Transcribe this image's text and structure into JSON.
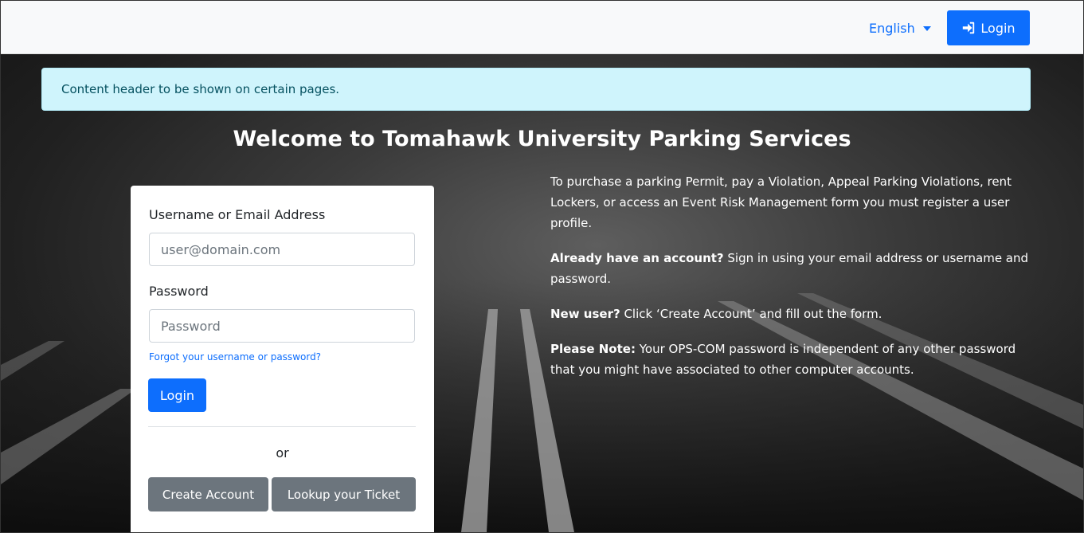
{
  "navbar": {
    "language": "English",
    "login_label": "Login"
  },
  "alert": {
    "text": "Content header to be shown on certain pages."
  },
  "welcome_title": "Welcome to Tomahawk University Parking Services",
  "login_form": {
    "username_label": "Username or Email Address",
    "username_placeholder": "user@domain.com",
    "password_label": "Password",
    "password_placeholder": "Password",
    "forgot_link": "Forgot your username or password?",
    "login_button": "Login",
    "or_text": "or",
    "create_account_button": "Create Account",
    "lookup_ticket_button": "Lookup your Ticket"
  },
  "info": {
    "intro": "To purchase a parking Permit, pay a Violation, Appeal Parking Violations, rent Lockers, or access an Event Risk Management form you must register a user profile.",
    "existing_bold": "Already have an account?",
    "existing_text": " Sign in using your email address or username and password.",
    "new_bold": "New user?",
    "new_text": " Click ‘Create Account’ and fill out the form.",
    "note_bold": "Please Note:",
    "note_text": " Your OPS-COM password is independent of any other password that you might have associated to other computer accounts."
  },
  "colors": {
    "primary": "#0d6efd",
    "secondary": "#6c757d",
    "alert_bg": "#cff4fc",
    "alert_text": "#055160"
  },
  "icons": {
    "nav_login": "sign-in-icon",
    "language_dropdown": "caret-down-icon"
  }
}
